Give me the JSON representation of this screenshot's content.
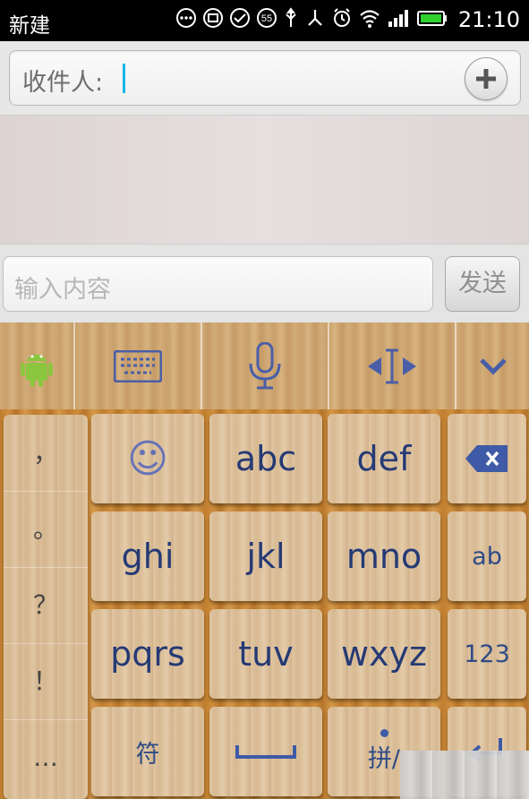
{
  "status_bar": {
    "carrier": "新建",
    "time": "21:10",
    "badge": "55",
    "icons": [
      "more-icon",
      "notification-icon",
      "check-icon",
      "badge-icon",
      "usb-icon",
      "bluetooth-icon",
      "alarm-icon",
      "wifi-icon",
      "signal-icon",
      "battery-icon"
    ]
  },
  "recipient": {
    "label": "收件人:"
  },
  "compose": {
    "placeholder": "输入内容",
    "send_label": "发送"
  },
  "ime_toolbar": {
    "items": [
      "android-icon",
      "keyboard-icon",
      "microphone-icon",
      "cursor-move-icon",
      "chevron-down-icon"
    ]
  },
  "keyboard": {
    "punctuation": [
      "，",
      "。",
      "？",
      "！",
      "…"
    ],
    "keys": {
      "smiley": "☺",
      "abc": "abc",
      "def": "def",
      "ghi": "ghi",
      "jkl": "jkl",
      "mno": "mno",
      "ab": "ab",
      "pqrs": "pqrs",
      "tuv": "tuv",
      "wxyz": "wxyz",
      "num": "123",
      "symbol": "符",
      "pinyin": "拼/"
    }
  },
  "colors": {
    "caret": "#18b7e8",
    "key_text": "#253a75",
    "toolbar_icon": "#4a5ea8",
    "android_green": "#8bc63f"
  }
}
